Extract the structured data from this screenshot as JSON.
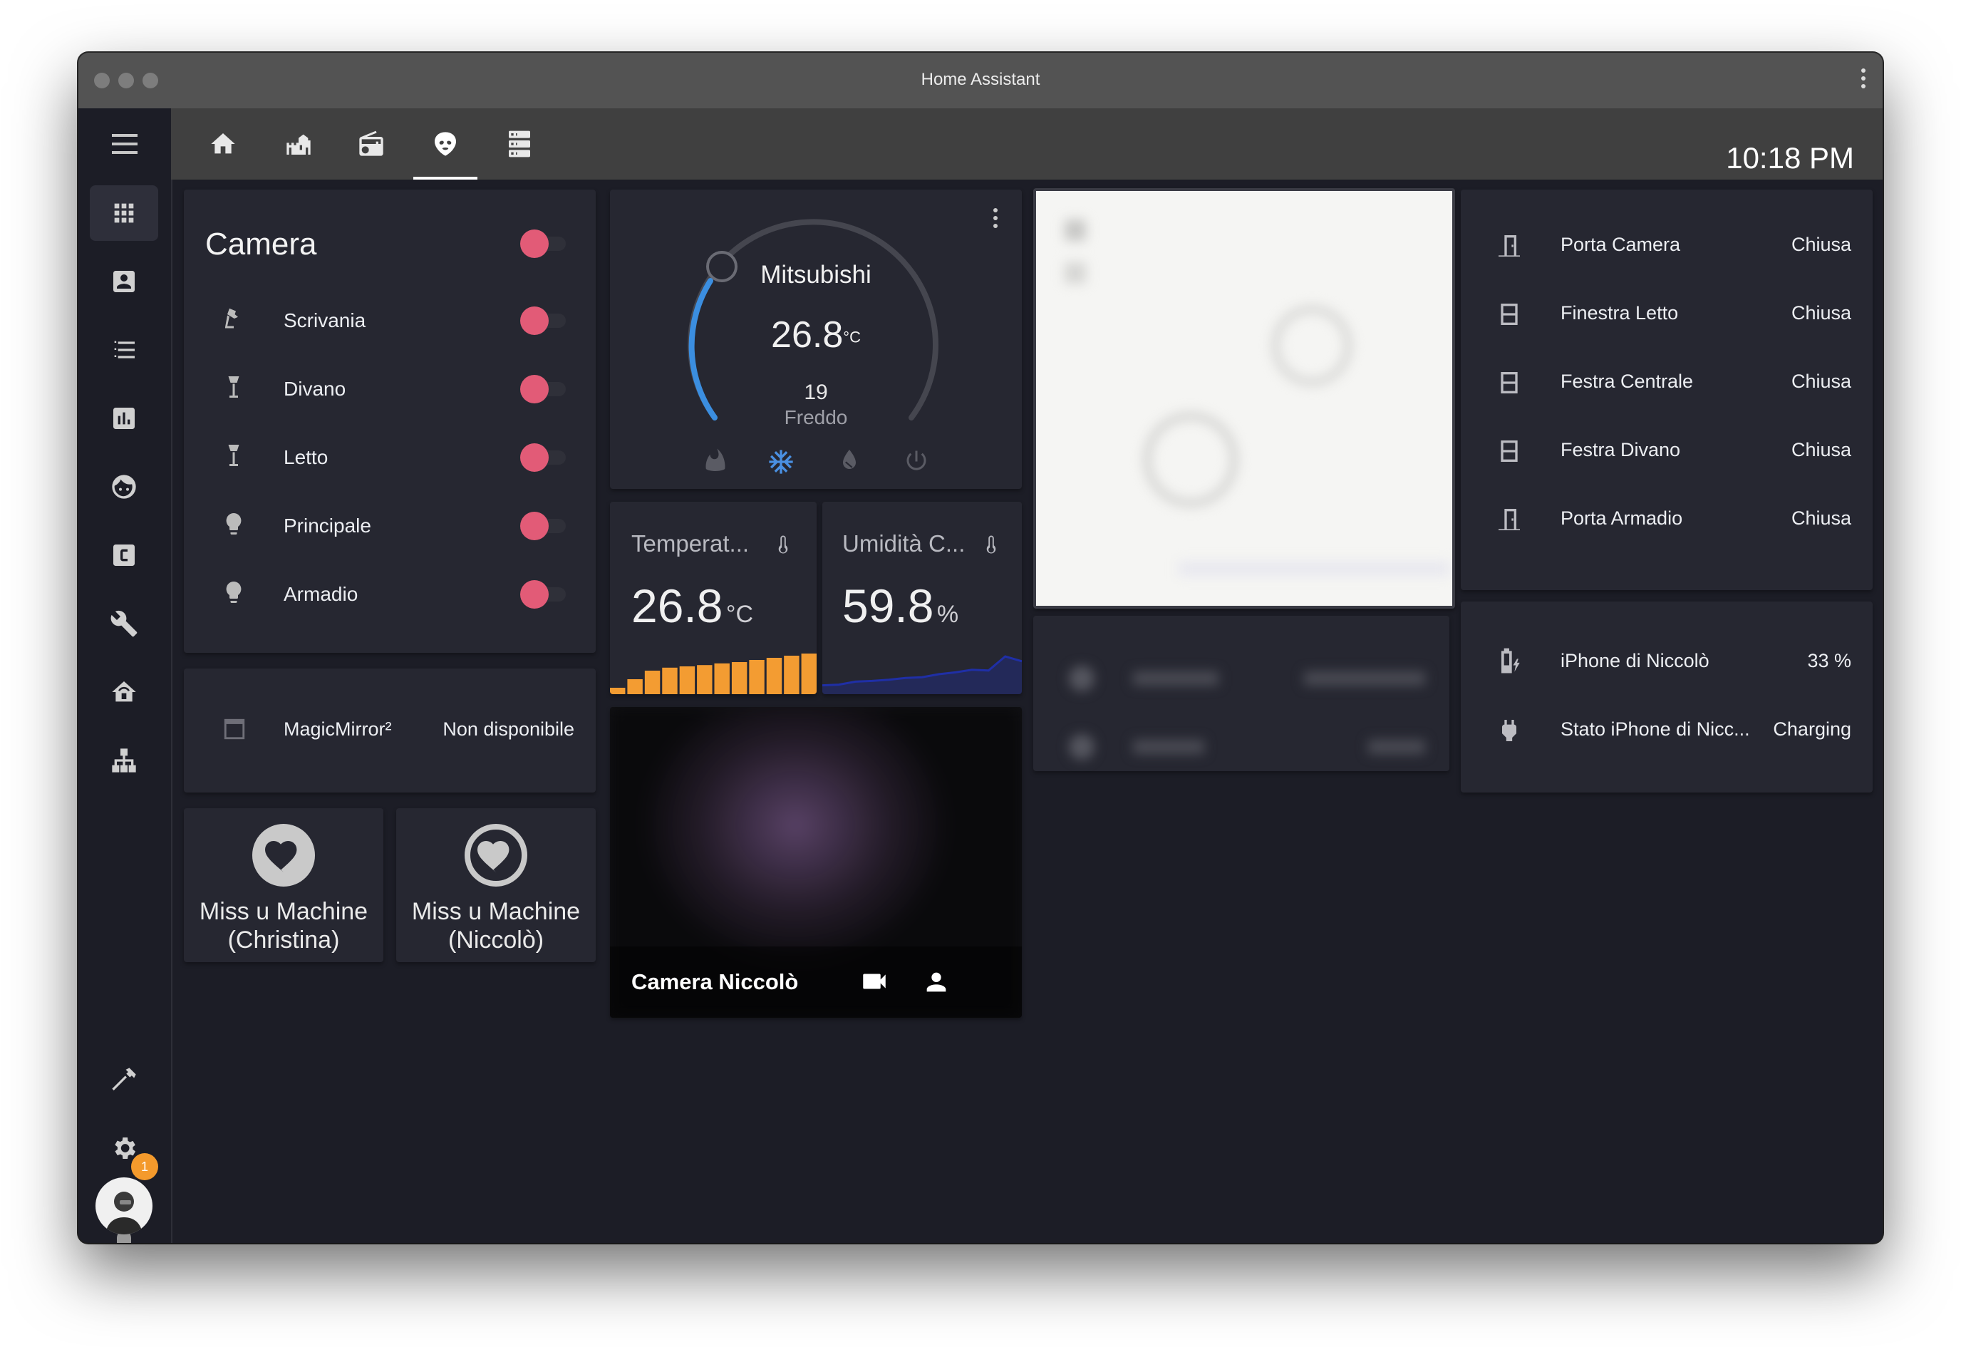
{
  "window": {
    "title": "Home Assistant"
  },
  "header": {
    "clock": "10:18 PM",
    "tabs": [
      {
        "icon": "home-icon"
      },
      {
        "icon": "castle-icon"
      },
      {
        "icon": "radio-icon"
      },
      {
        "icon": "alien-icon",
        "active": true
      },
      {
        "icon": "server-icon"
      }
    ]
  },
  "sidebar": {
    "items": [
      {
        "icon": "apps-grid-icon",
        "active": true
      },
      {
        "icon": "account-box-icon"
      },
      {
        "icon": "format-list-icon"
      },
      {
        "icon": "chart-box-icon"
      },
      {
        "icon": "face-icon"
      },
      {
        "icon": "letter-c-icon"
      },
      {
        "icon": "wrench-icon"
      },
      {
        "icon": "home-automation-icon"
      },
      {
        "icon": "sitemap-icon"
      },
      {
        "icon": "hammer-icon"
      },
      {
        "icon": "gear-icon"
      }
    ],
    "notification_count": "1"
  },
  "lights_card": {
    "title": "Camera",
    "rows": [
      {
        "label": "Scrivania",
        "icon": "desk-lamp-icon"
      },
      {
        "label": "Divano",
        "icon": "floor-lamp-icon"
      },
      {
        "label": "Letto",
        "icon": "floor-lamp-icon"
      },
      {
        "label": "Principale",
        "icon": "lightbulb-icon"
      },
      {
        "label": "Armadio",
        "icon": "lightbulb-icon"
      }
    ]
  },
  "magicmirror": {
    "label": "MagicMirror²",
    "state": "Non disponibile"
  },
  "buttons": [
    {
      "line1": "Miss u Machine",
      "line2": "(Christina)"
    },
    {
      "line1": "Miss u Machine",
      "line2": "(Niccolò)"
    }
  ],
  "thermostat": {
    "name": "Mitsubishi",
    "current": "26.8",
    "unit": "°C",
    "target": "19",
    "mode": "Freddo",
    "modes": [
      "fire-icon",
      "snowflake-icon",
      "water-off-icon",
      "power-icon"
    ],
    "active_mode_color": "#4a90e2"
  },
  "temperature_sensor": {
    "name": "Temperat...",
    "value": "26.8",
    "unit": "°C",
    "bars": [
      0.15,
      0.35,
      0.55,
      0.62,
      0.65,
      0.68,
      0.72,
      0.75,
      0.8,
      0.85,
      0.9,
      0.95
    ],
    "bar_color": "#f39c32"
  },
  "humidity_sensor": {
    "name": "Umidità C...",
    "value": "59.8",
    "unit": "%",
    "line": [
      0.2,
      0.22,
      0.3,
      0.32,
      0.35,
      0.4,
      0.42,
      0.5,
      0.55,
      0.62,
      0.6,
      0.98,
      0.85
    ],
    "line_color": "#1f2fa6"
  },
  "camera": {
    "name": "Camera Niccolò"
  },
  "doors_card": {
    "rows": [
      {
        "label": "Porta Camera",
        "state": "Chiusa",
        "icon": "door-closed-icon"
      },
      {
        "label": "Finestra Letto",
        "state": "Chiusa",
        "icon": "window-closed-icon"
      },
      {
        "label": "Festra Centrale",
        "state": "Chiusa",
        "icon": "window-closed-icon"
      },
      {
        "label": "Festra Divano",
        "state": "Chiusa",
        "icon": "window-closed-icon"
      },
      {
        "label": "Porta Armadio",
        "state": "Chiusa",
        "icon": "door-closed-icon"
      }
    ]
  },
  "phone_card": {
    "rows": [
      {
        "label": "iPhone di Niccolò",
        "state": "33 %",
        "icon": "battery-charging-icon"
      },
      {
        "label": "Stato iPhone di Nicc...",
        "state": "Charging",
        "icon": "power-plug-icon"
      }
    ]
  },
  "colors": {
    "toggle_on": "#e25b77",
    "card_bg": "#262731",
    "page_bg": "#1c1d26"
  }
}
